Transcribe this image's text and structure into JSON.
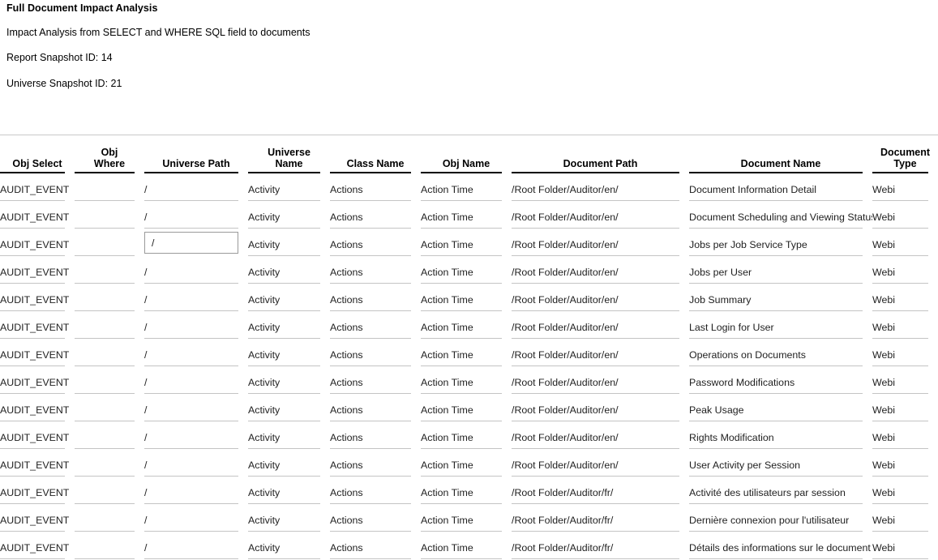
{
  "report": {
    "title": "Full Document Impact Analysis",
    "subtitle": "Impact Analysis from SELECT and WHERE SQL field to documents",
    "report_snapshot_label": "Report Snapshot ID: 14",
    "universe_snapshot_label": "Universe Snapshot ID: 21"
  },
  "table": {
    "columns": [
      {
        "key": "obj_select",
        "label": "Obj Select"
      },
      {
        "key": "obj_where",
        "label": "Obj\nWhere"
      },
      {
        "key": "universe_path",
        "label": "Universe Path"
      },
      {
        "key": "universe_name",
        "label": "Universe\nName"
      },
      {
        "key": "class_name",
        "label": "Class Name"
      },
      {
        "key": "obj_name",
        "label": "Obj Name"
      },
      {
        "key": "document_path",
        "label": "Document Path"
      },
      {
        "key": "document_name",
        "label": "Document Name"
      },
      {
        "key": "document_type",
        "label": "Document\nType"
      }
    ],
    "focused_cell": {
      "row": 2,
      "col": 2
    },
    "rows": [
      {
        "obj_select": "AUDIT_EVENT",
        "obj_where": "",
        "universe_path": "/",
        "universe_name": "Activity",
        "class_name": "Actions",
        "obj_name": "Action Time",
        "document_path": "/Root Folder/Auditor/en/",
        "document_name": "Document Information Detail",
        "document_type": "Webi"
      },
      {
        "obj_select": "AUDIT_EVENT",
        "obj_where": "",
        "universe_path": "/",
        "universe_name": "Activity",
        "class_name": "Actions",
        "obj_name": "Action Time",
        "document_path": "/Root Folder/Auditor/en/",
        "document_name": "Document Scheduling and Viewing Status",
        "document_type": "Webi"
      },
      {
        "obj_select": "AUDIT_EVENT",
        "obj_where": "",
        "universe_path": "/",
        "universe_name": "Activity",
        "class_name": "Actions",
        "obj_name": "Action Time",
        "document_path": "/Root Folder/Auditor/en/",
        "document_name": "Jobs per Job Service Type",
        "document_type": "Webi"
      },
      {
        "obj_select": "AUDIT_EVENT",
        "obj_where": "",
        "universe_path": "/",
        "universe_name": "Activity",
        "class_name": "Actions",
        "obj_name": "Action Time",
        "document_path": "/Root Folder/Auditor/en/",
        "document_name": "Jobs per User",
        "document_type": "Webi"
      },
      {
        "obj_select": "AUDIT_EVENT",
        "obj_where": "",
        "universe_path": "/",
        "universe_name": "Activity",
        "class_name": "Actions",
        "obj_name": "Action Time",
        "document_path": "/Root Folder/Auditor/en/",
        "document_name": "Job Summary",
        "document_type": "Webi"
      },
      {
        "obj_select": "AUDIT_EVENT",
        "obj_where": "",
        "universe_path": "/",
        "universe_name": "Activity",
        "class_name": "Actions",
        "obj_name": "Action Time",
        "document_path": "/Root Folder/Auditor/en/",
        "document_name": "Last Login for User",
        "document_type": "Webi"
      },
      {
        "obj_select": "AUDIT_EVENT",
        "obj_where": "",
        "universe_path": "/",
        "universe_name": "Activity",
        "class_name": "Actions",
        "obj_name": "Action Time",
        "document_path": "/Root Folder/Auditor/en/",
        "document_name": "Operations on Documents",
        "document_type": "Webi"
      },
      {
        "obj_select": "AUDIT_EVENT",
        "obj_where": "",
        "universe_path": "/",
        "universe_name": "Activity",
        "class_name": "Actions",
        "obj_name": "Action Time",
        "document_path": "/Root Folder/Auditor/en/",
        "document_name": "Password Modifications",
        "document_type": "Webi"
      },
      {
        "obj_select": "AUDIT_EVENT",
        "obj_where": "",
        "universe_path": "/",
        "universe_name": "Activity",
        "class_name": "Actions",
        "obj_name": "Action Time",
        "document_path": "/Root Folder/Auditor/en/",
        "document_name": "Peak Usage",
        "document_type": "Webi"
      },
      {
        "obj_select": "AUDIT_EVENT",
        "obj_where": "",
        "universe_path": "/",
        "universe_name": "Activity",
        "class_name": "Actions",
        "obj_name": "Action Time",
        "document_path": "/Root Folder/Auditor/en/",
        "document_name": "Rights Modification",
        "document_type": "Webi"
      },
      {
        "obj_select": "AUDIT_EVENT",
        "obj_where": "",
        "universe_path": "/",
        "universe_name": "Activity",
        "class_name": "Actions",
        "obj_name": "Action Time",
        "document_path": "/Root Folder/Auditor/en/",
        "document_name": "User Activity per Session",
        "document_type": "Webi"
      },
      {
        "obj_select": "AUDIT_EVENT",
        "obj_where": "",
        "universe_path": "/",
        "universe_name": "Activity",
        "class_name": "Actions",
        "obj_name": "Action Time",
        "document_path": "/Root Folder/Auditor/fr/",
        "document_name": "Activité des utilisateurs par session",
        "document_type": "Webi"
      },
      {
        "obj_select": "AUDIT_EVENT",
        "obj_where": "",
        "universe_path": "/",
        "universe_name": "Activity",
        "class_name": "Actions",
        "obj_name": "Action Time",
        "document_path": "/Root Folder/Auditor/fr/",
        "document_name": "Dernière connexion pour l'utilisateur",
        "document_type": "Webi"
      },
      {
        "obj_select": "AUDIT_EVENT",
        "obj_where": "",
        "universe_path": "/",
        "universe_name": "Activity",
        "class_name": "Actions",
        "obj_name": "Action Time",
        "document_path": "/Root Folder/Auditor/fr/",
        "document_name": "Détails des informations sur le document",
        "document_type": "Webi"
      }
    ]
  }
}
